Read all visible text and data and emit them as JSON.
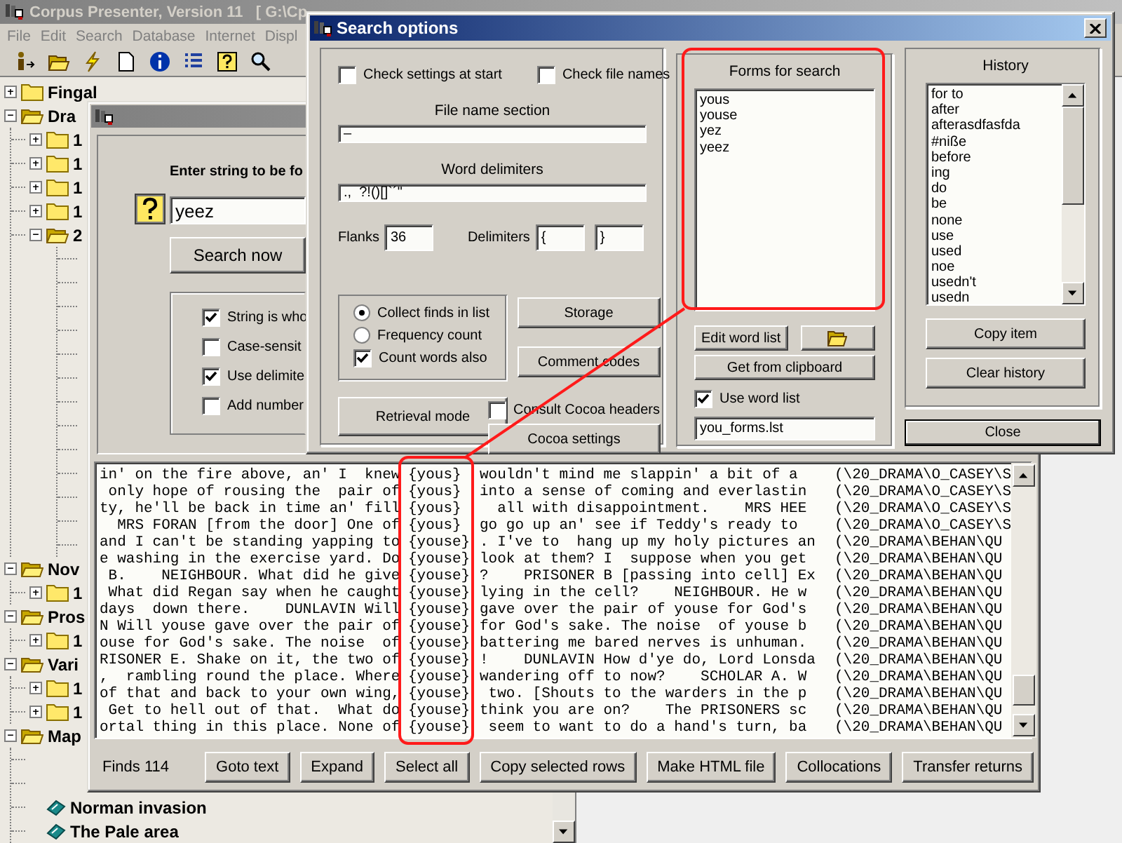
{
  "main_window": {
    "title": "Corpus Presenter, Version 11   [ G:\\Cp",
    "menu": [
      "File",
      "Edit",
      "Search",
      "Database",
      "Internet",
      "Displ"
    ]
  },
  "tree": [
    {
      "kind": "folder",
      "label": "Fingal",
      "expanded": false
    },
    {
      "kind": "folder",
      "label": "Dra",
      "expanded": true,
      "children": [
        {
          "kind": "folder",
          "label": "1",
          "expanded": false
        },
        {
          "kind": "folder",
          "label": "1",
          "expanded": false
        },
        {
          "kind": "folder",
          "label": "1",
          "expanded": false
        },
        {
          "kind": "folder",
          "label": "1",
          "expanded": false
        },
        {
          "kind": "folder",
          "label": "2",
          "expanded": true,
          "children": [
            {
              "kind": "leaf"
            },
            {
              "kind": "leaf"
            },
            {
              "kind": "leaf"
            },
            {
              "kind": "leaf"
            },
            {
              "kind": "leaf"
            },
            {
              "kind": "leaf"
            },
            {
              "kind": "leaf"
            },
            {
              "kind": "leaf"
            },
            {
              "kind": "leaf"
            },
            {
              "kind": "leaf"
            },
            {
              "kind": "leaf"
            },
            {
              "kind": "leaf"
            },
            {
              "kind": "leaf"
            }
          ]
        }
      ]
    },
    {
      "kind": "folder",
      "label": "Nov",
      "expanded": true,
      "children": [
        {
          "kind": "folder",
          "label": "1",
          "expanded": false
        }
      ]
    },
    {
      "kind": "folder",
      "label": "Pros",
      "expanded": true,
      "children": [
        {
          "kind": "folder",
          "label": "1",
          "expanded": false
        }
      ]
    },
    {
      "kind": "folder",
      "label": "Vari",
      "expanded": true,
      "children": [
        {
          "kind": "folder",
          "label": "1",
          "expanded": false
        },
        {
          "kind": "folder",
          "label": "1",
          "expanded": false
        }
      ]
    },
    {
      "kind": "folder",
      "label": "Map",
      "expanded": true,
      "children": [
        {
          "kind": "topic"
        },
        {
          "kind": "topic"
        },
        {
          "kind": "topic",
          "label": "Norman invasion"
        },
        {
          "kind": "topic",
          "label": "The Pale area"
        }
      ]
    }
  ],
  "search_window": {
    "prompt": "Enter string to be fo",
    "query": "yeez",
    "search_button": "Search now",
    "options": [
      {
        "label": "String is who",
        "checked": true
      },
      {
        "label": "Case-sensit",
        "checked": false
      },
      {
        "label": "Use delimite",
        "checked": true
      },
      {
        "label": "Add number",
        "checked": false
      }
    ],
    "concordance": [
      {
        "left": "in' on the fire above, an' I  knew",
        "keyword": "{yous}",
        "right": "wouldn't mind me slappin' a bit of a",
        "source": "(\\20_DRAMA\\O_CASEY\\S"
      },
      {
        "left": " only hope of rousing the  pair of",
        "keyword": "{yous}",
        "right": "into a sense of coming and everlastin",
        "source": "(\\20_DRAMA\\O_CASEY\\S"
      },
      {
        "left": "ty, he'll be back in time an' fill",
        "keyword": "{yous}",
        "right": "  all with disappointment.    MRS HEE",
        "source": "(\\20_DRAMA\\O_CASEY\\S"
      },
      {
        "left": "  MRS FORAN [from the door] One of",
        "keyword": "{yous}",
        "right": "go go up an' see if Teddy's ready to",
        "source": "(\\20_DRAMA\\O_CASEY\\S"
      },
      {
        "left": "and I can't be standing yapping to",
        "keyword": "{youse}",
        "right": ". I've to  hang up my holy pictures an",
        "source": "(\\20_DRAMA\\BEHAN\\QU"
      },
      {
        "left": "e washing in the exercise yard. Do",
        "keyword": "{youse}",
        "right": "look at them? I  suppose when you get",
        "source": "(\\20_DRAMA\\BEHAN\\QU"
      },
      {
        "left": " B.    NEIGHBOUR. What did he give",
        "keyword": "{youse}",
        "right": "?    PRISONER B [passing into cell] Ex",
        "source": "(\\20_DRAMA\\BEHAN\\QU"
      },
      {
        "left": " What did Regan say when he caught",
        "keyword": "{youse}",
        "right": "lying in the cell?    NEIGHBOUR. He w",
        "source": "(\\20_DRAMA\\BEHAN\\QU"
      },
      {
        "left": "days  down there.    DUNLAVIN Will",
        "keyword": "{youse}",
        "right": "gave over the pair of youse for God's",
        "source": "(\\20_DRAMA\\BEHAN\\QU"
      },
      {
        "left": "N Will youse gave over the pair of",
        "keyword": "{youse}",
        "right": "for God's sake. The noise  of youse b",
        "source": "(\\20_DRAMA\\BEHAN\\QU"
      },
      {
        "left": "ouse for God's sake. The noise  of",
        "keyword": "{youse}",
        "right": "battering me bared nerves is unhuman.",
        "source": "(\\20_DRAMA\\BEHAN\\QU"
      },
      {
        "left": "RISONER E. Shake on it, the two of",
        "keyword": "{youse}",
        "right": "!    DUNLAVIN How d'ye do, Lord Lonsda",
        "source": "(\\20_DRAMA\\BEHAN\\QU"
      },
      {
        "left": ",  rambling round the place. Where",
        "keyword": "{youse}",
        "right": "wandering off to now?    SCHOLAR A. W",
        "source": "(\\20_DRAMA\\BEHAN\\QU"
      },
      {
        "left": "of that and back to your own wing,",
        "keyword": "{youse}",
        "right": " two. [Shouts to the warders in the p",
        "source": "(\\20_DRAMA\\BEHAN\\QU"
      },
      {
        "left": " Get to hell out of that.  What do",
        "keyword": "{youse}",
        "right": "think you are on?    The PRISONERS sc",
        "source": "(\\20_DRAMA\\BEHAN\\QU"
      },
      {
        "left": "ortal thing in this place. None of",
        "keyword": "{youse}",
        "right": " seem to want to do a hand's turn, ba",
        "source": "(\\20_DRAMA\\BEHAN\\QU"
      }
    ],
    "finds_label": "Finds",
    "finds_count": "114",
    "buttons": [
      "Goto text",
      "Expand",
      "Select all",
      "Copy selected rows",
      "Make HTML file",
      "Collocations",
      "Transfer returns"
    ]
  },
  "search_options": {
    "title": "Search options",
    "checkboxes": [
      {
        "label": "Check settings at start",
        "checked": false
      },
      {
        "label": "Check file names",
        "checked": false
      }
    ],
    "file_name_section": {
      "label": "File name section",
      "value": "–"
    },
    "word_delimiters": {
      "label": "Word delimiters",
      "value": ".,  ?!()[]`´\""
    },
    "flanks": {
      "label": "Flanks",
      "value": "36"
    },
    "delimiters": {
      "label": "Delimiters",
      "open": "{",
      "close": "}"
    },
    "mode_options": [
      {
        "kind": "radio",
        "label": "Collect finds in list",
        "selected": true
      },
      {
        "kind": "radio",
        "label": "Frequency count",
        "selected": false
      },
      {
        "kind": "checkbox",
        "label": "Count words also",
        "checked": true
      }
    ],
    "storage_button": "Storage",
    "comment_codes_button": "Comment codes",
    "retrieval_mode_button": "Retrieval mode",
    "consult_cocoa": {
      "label": "Consult Cocoa headers",
      "checked": false
    },
    "cocoa_settings_button": "Cocoa settings",
    "forms": {
      "label": "Forms for search",
      "items": [
        "yous",
        "youse",
        "yez",
        "yeez"
      ]
    },
    "edit_word_list_button": "Edit word list",
    "get_from_clipboard_button": "Get from clipboard",
    "use_word_list": {
      "label": "Use word list",
      "checked": true
    },
    "word_list_file": "you_forms.lst",
    "history": {
      "label": "History",
      "items": [
        "for to",
        "after",
        "afterasdfasfda",
        "#nißе",
        "before",
        "ing",
        "do",
        "be",
        "none",
        "use",
        "used",
        "noe",
        "usedn't",
        "usedn"
      ]
    },
    "copy_item_button": "Copy item",
    "clear_history_button": "Clear history",
    "close_button": "Close"
  }
}
